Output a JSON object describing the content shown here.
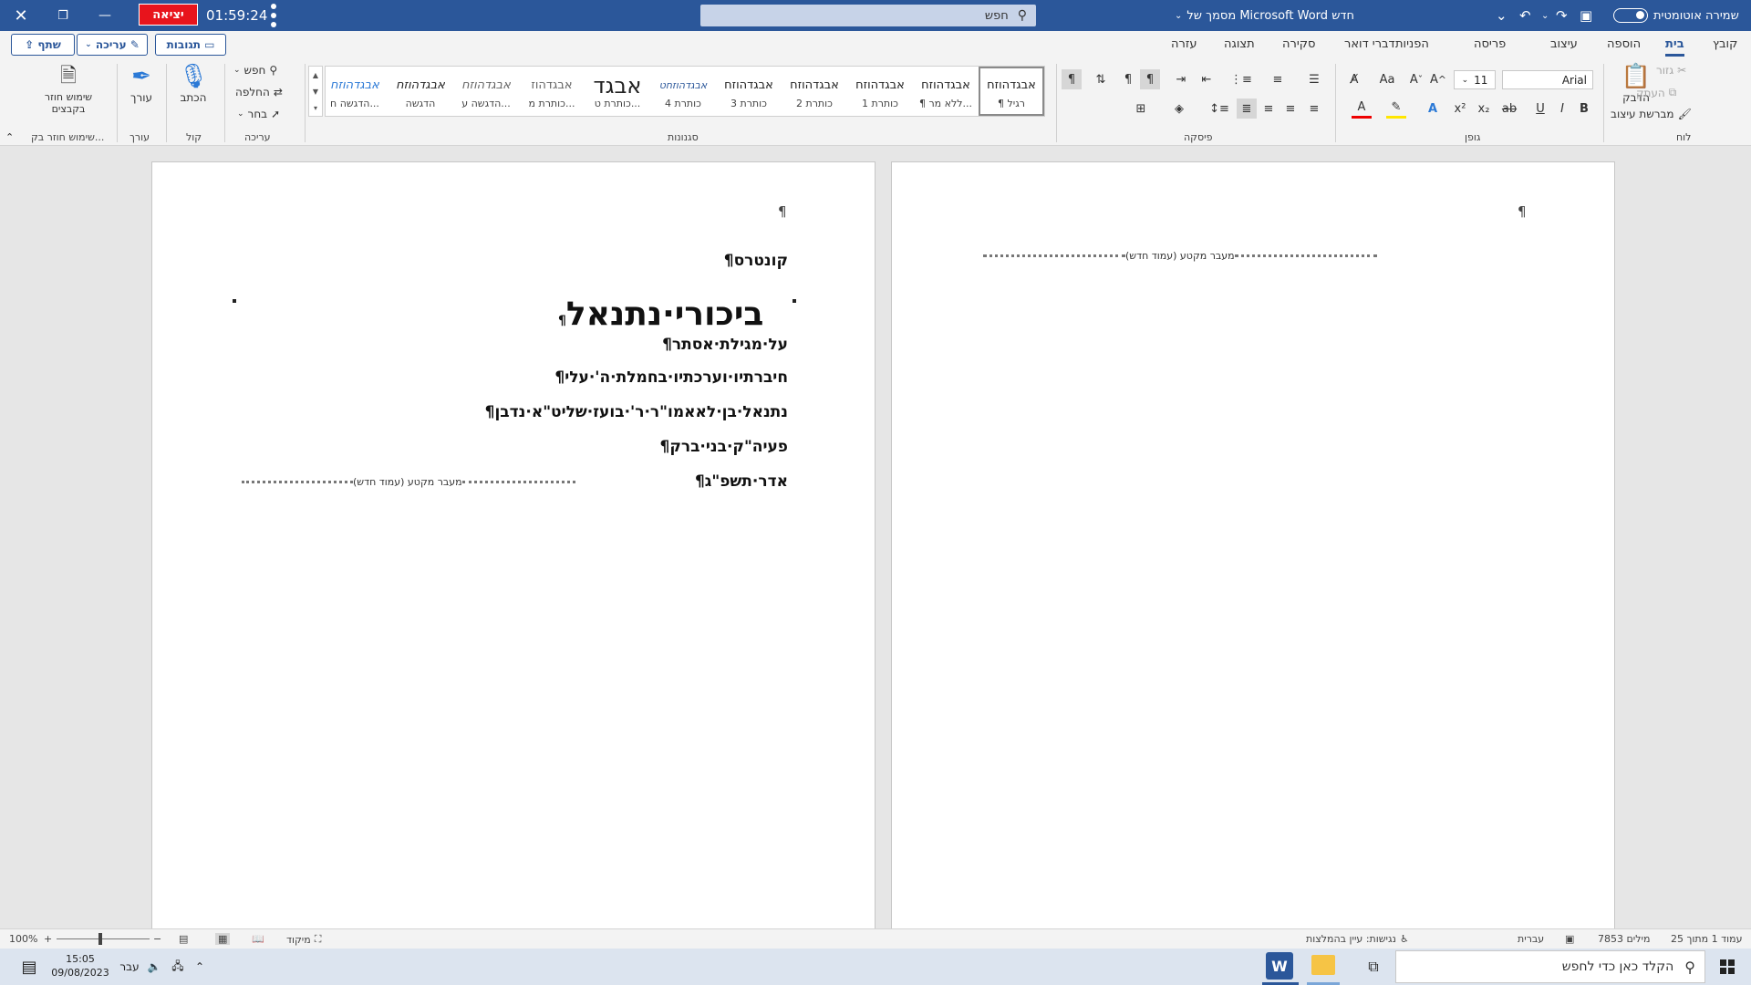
{
  "titlebar": {
    "exit_label": "יציאה",
    "timer": "01:59:24",
    "search_placeholder": "חפש",
    "doc_title": "מסמך של Microsoft Word חדש",
    "autosave_label": "שמירה אוטומטית"
  },
  "tabs": [
    "קובץ",
    "בית",
    "הוספה",
    "עיצוב",
    "פריסה",
    "הפניות",
    "דברי דואר",
    "סקירה",
    "תצוגה",
    "עזרה"
  ],
  "active_tab": "בית",
  "actions": {
    "share": "שתף",
    "edit": "עריכה",
    "comments": "תגובות"
  },
  "ribbon": {
    "clipboard": {
      "label": "לוח",
      "paste": "הדבק",
      "cut": "גזור",
      "copy": "העתק",
      "format_painter": "מברשת עיצוב"
    },
    "font": {
      "label": "גופן",
      "name": "Arial",
      "size": "11"
    },
    "paragraph": {
      "label": "פיסקה"
    },
    "styles": {
      "label": "סגנונות",
      "items": [
        {
          "sample": "אבגדהוזח",
          "name": "¶ רגיל"
        },
        {
          "sample": "אבגדהוזח",
          "name": "¶ ללא מר..."
        },
        {
          "sample": "אבגדהוזח",
          "name": "כותרת 1"
        },
        {
          "sample": "אבגדהוזח",
          "name": "כותרת 2"
        },
        {
          "sample": "אבגדהוזח",
          "name": "כותרת 3"
        },
        {
          "sample": "אבגדהוזחט",
          "name": "כותרת 4"
        },
        {
          "sample": "אבגד",
          "name": "כותרת ט..."
        },
        {
          "sample": "אבגדהוז",
          "name": "כותרת מ..."
        },
        {
          "sample": "אבגדהוזח",
          "name": "הדגשה ע..."
        },
        {
          "sample": "אבגדהוזח",
          "name": "הדגשה"
        },
        {
          "sample": "אבגדהוזח",
          "name": "הדגשה ח..."
        }
      ]
    },
    "editing": {
      "label": "עריכה",
      "find": "חפש",
      "replace": "החלפה",
      "select": "בחר"
    },
    "voice": {
      "label": "קול",
      "dictate": "הכתב"
    },
    "editor": {
      "label": "עורך",
      "editor": "עורך"
    },
    "reuse": {
      "label": "שימוש חוזר בק...",
      "button": "שימוש חוזר בקבצים"
    }
  },
  "document": {
    "section_break": "מעבר מקטע (עמוד חדש)",
    "left_page": {
      "lines": [
        "קונטרס¶",
        "ביכורי·נתנאל",
        "על·מגילת·אסתר¶",
        "חיברתיו·וערכתיו·בחמלת·ה'·עלי¶",
        "נתנאל·בן·לאאמו\"ר·ר'·בועז·שליט\"א·נדבן¶",
        "פעיה\"ק·בני·ברק¶",
        "אדר·תשפ\"ג¶"
      ]
    }
  },
  "statusbar": {
    "page": "עמוד 1 מתוך 25",
    "words": "7853 מילים",
    "language": "עברית",
    "accessibility": "נגישות: עיין בהמלצות",
    "focus": "מיקוד",
    "zoom": "100%"
  },
  "taskbar": {
    "search_placeholder": "הקלד כאן כדי לחפש",
    "time": "15:05",
    "date": "09/08/2023",
    "lang": "עבר"
  }
}
